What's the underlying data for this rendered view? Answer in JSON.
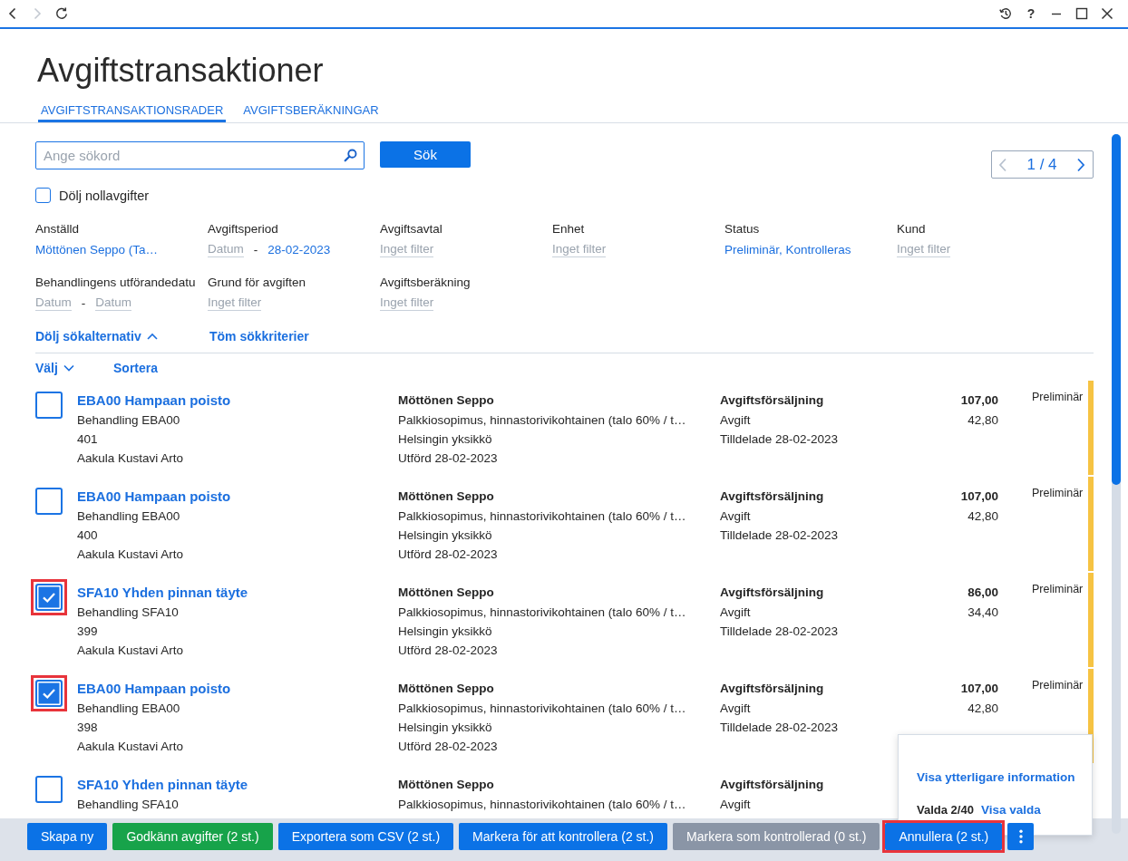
{
  "toolbar": {
    "nav_buttons": [
      {
        "kind": "back",
        "disabled": false
      },
      {
        "kind": "forward",
        "disabled": true
      },
      {
        "kind": "refresh",
        "disabled": false
      }
    ],
    "window_buttons": [
      {
        "kind": "history"
      },
      {
        "kind": "help",
        "label": "?"
      },
      {
        "kind": "minimize"
      },
      {
        "kind": "maximize"
      },
      {
        "kind": "close"
      }
    ]
  },
  "title": "Avgiftstransaktioner",
  "tabs": [
    {
      "label": "AVGIFTSTRANSAKTIONSRADER",
      "selected": true
    },
    {
      "label": "AVGIFTSBERÄKNINGAR",
      "selected": false
    }
  ],
  "search": {
    "placeholder": "Ange sökord",
    "button": "Sök"
  },
  "pager": {
    "page": "1 / 4",
    "prev_disabled": true,
    "next_disabled": false
  },
  "hide_zero": {
    "label": "Dölj nollavgifter",
    "checked": false
  },
  "filters": [
    {
      "label": "Anställd",
      "fields": [
        {
          "value": "Möttönen Seppo (Ta…"
        }
      ]
    },
    {
      "label": "Avgiftsperiod",
      "separator": "-",
      "fields": [
        {
          "placeholder": "Datum"
        },
        {
          "value": "28-02-2023"
        }
      ]
    },
    {
      "label": "Avgiftsavtal",
      "fields": [
        {
          "placeholder": "Inget filter"
        }
      ]
    },
    {
      "label": "Enhet",
      "fields": [
        {
          "placeholder": "Inget filter"
        }
      ]
    },
    {
      "label": "Status",
      "fields": [
        {
          "value": "Preliminär, Kontrolleras"
        }
      ]
    },
    {
      "label": "Kund",
      "fields": [
        {
          "placeholder": "Inget filter"
        }
      ]
    },
    {
      "label": "Behandlingens utförandedatu",
      "separator": "-",
      "fields": [
        {
          "placeholder": "Datum"
        },
        {
          "placeholder": "Datum"
        }
      ]
    },
    {
      "label": "Grund för avgiften",
      "fields": [
        {
          "placeholder": "Inget filter"
        }
      ]
    },
    {
      "label": "Avgiftsberäkning",
      "fields": [
        {
          "placeholder": "Inget filter"
        }
      ]
    }
  ],
  "search_options": {
    "label": "Dölj sökalternativ",
    "expanded": true,
    "clear": "Töm sökkriterier"
  },
  "list_tools": {
    "select": "Välj",
    "sort": "Sortera"
  },
  "rows": [
    {
      "title": "EBA00 Hampaan poisto",
      "treatment": "Behandling EBA00",
      "number": "401",
      "provider": "Aakula Kustavi Arto",
      "employee": "Möttönen Seppo",
      "agreement": "Palkkiosopimus, hinnastorivikohtainen (talo 60% / t…",
      "unit": "Helsingin yksikkö",
      "performed": "Utförd 28-02-2023",
      "category": "Avgiftsförsäljning",
      "type": "Avgift",
      "assigned": "Tilldelade 28-02-2023",
      "amount": "107,00",
      "fee": "42,80",
      "status": "Preliminär",
      "color": "#f6c343",
      "checked": false,
      "highlighted": false
    },
    {
      "title": "EBA00 Hampaan poisto",
      "treatment": "Behandling EBA00",
      "number": "400",
      "provider": "Aakula Kustavi Arto",
      "employee": "Möttönen Seppo",
      "agreement": "Palkkiosopimus, hinnastorivikohtainen (talo 60% / t…",
      "unit": "Helsingin yksikkö",
      "performed": "Utförd 28-02-2023",
      "category": "Avgiftsförsäljning",
      "type": "Avgift",
      "assigned": "Tilldelade 28-02-2023",
      "amount": "107,00",
      "fee": "42,80",
      "status": "Preliminär",
      "color": "#f6c343",
      "checked": false,
      "highlighted": false
    },
    {
      "title": "SFA10 Yhden pinnan täyte",
      "treatment": "Behandling SFA10",
      "number": "399",
      "provider": "Aakula Kustavi Arto",
      "employee": "Möttönen Seppo",
      "agreement": "Palkkiosopimus, hinnastorivikohtainen (talo 60% / t…",
      "unit": "Helsingin yksikkö",
      "performed": "Utförd 28-02-2023",
      "category": "Avgiftsförsäljning",
      "type": "Avgift",
      "assigned": "Tilldelade 28-02-2023",
      "amount": "86,00",
      "fee": "34,40",
      "status": "Preliminär",
      "color": "#f6c343",
      "checked": true,
      "highlighted": true
    },
    {
      "title": "EBA00 Hampaan poisto",
      "treatment": "Behandling EBA00",
      "number": "398",
      "provider": "Aakula Kustavi Arto",
      "employee": "Möttönen Seppo",
      "agreement": "Palkkiosopimus, hinnastorivikohtainen (talo 60% / t…",
      "unit": "Helsingin yksikkö",
      "performed": "Utförd 28-02-2023",
      "category": "Avgiftsförsäljning",
      "type": "Avgift",
      "assigned": "Tilldelade 28-02-2023",
      "amount": "107,00",
      "fee": "42,80",
      "status": "Preliminär",
      "color": "#f6c343",
      "checked": true,
      "highlighted": true
    },
    {
      "title": "SFA10 Yhden pinnan täyte",
      "treatment": "Behandling SFA10",
      "employee": "Möttönen Seppo",
      "agreement": "Palkkiosopimus, hinnastorivikohtainen (talo 60% / t…",
      "category": "Avgiftsförsäljning",
      "type": "Avgift",
      "checked": false,
      "highlighted": false
    }
  ],
  "selection_popup": {
    "info_link": "Visa ytterligare information",
    "count": "Valda 2/40",
    "show_selected": "Visa valda"
  },
  "actions": [
    {
      "kind": "primary",
      "label": "Skapa ny",
      "disabled": false,
      "highlighted": false
    },
    {
      "kind": "success",
      "label": "Godkänn avgifter (2 st.)",
      "disabled": false,
      "highlighted": false
    },
    {
      "kind": "primary",
      "label": "Exportera som CSV (2 st.)",
      "disabled": false,
      "highlighted": false
    },
    {
      "kind": "primary",
      "label": "Markera för att kontrollera (2 st.)",
      "disabled": false,
      "highlighted": false
    },
    {
      "kind": "primary",
      "label": "Markera som kontrollerad (0 st.)",
      "disabled": true,
      "highlighted": false
    },
    {
      "kind": "primary",
      "label": "Annullera (2 st.)",
      "disabled": false,
      "highlighted": true
    },
    {
      "kind": "more",
      "disabled": false,
      "highlighted": false
    }
  ]
}
